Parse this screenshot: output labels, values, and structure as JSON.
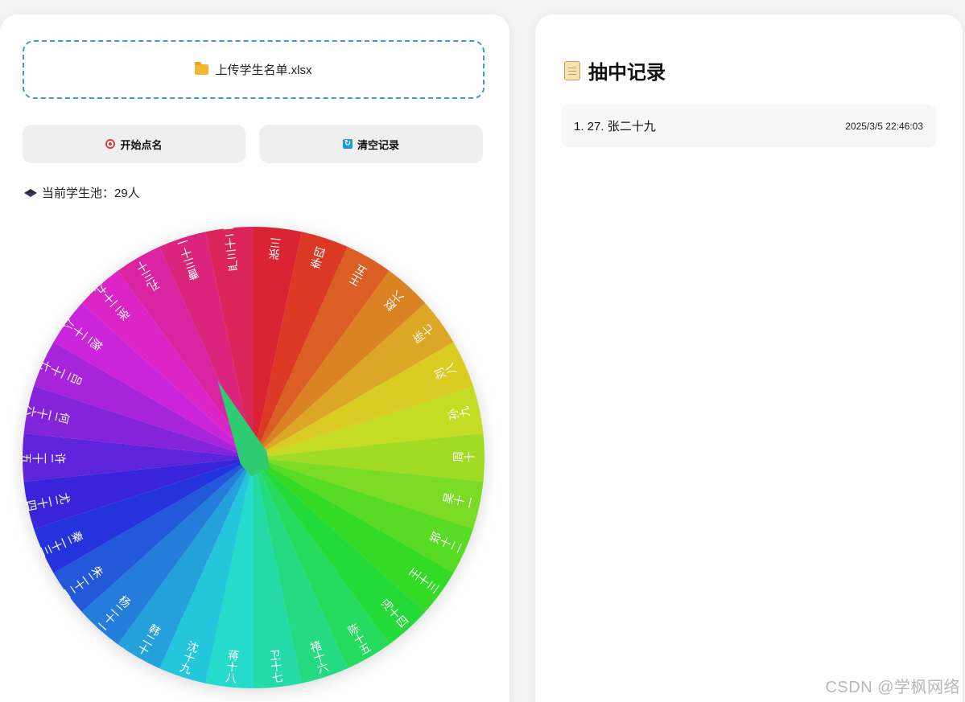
{
  "upload": {
    "icon": "folder-icon",
    "label": "上传学生名单.xlsx"
  },
  "buttons": {
    "start": {
      "icon": "target-icon",
      "label": "开始点名"
    },
    "clear": {
      "icon": "refresh-icon",
      "label": "清空记录"
    }
  },
  "pool": {
    "icon": "graduation-cap-icon",
    "label": "当前学生池：29人"
  },
  "wheel": {
    "names": [
      "张三",
      "李四",
      "王五",
      "赵六",
      "陈七",
      "刘八",
      "孙九",
      "周十",
      "吴十一",
      "郑十二",
      "王十三",
      "冯十四",
      "陈十五",
      "褚十六",
      "卫十七",
      "蒋十八",
      "沈十九",
      "韩二十",
      "杨二十一",
      "朱二十二",
      "秦二十三",
      "尤二十四",
      "许二十五",
      "何二十六",
      "吕二十七",
      "施二十八",
      "张二十九",
      "孔三十",
      "曹三十一",
      "严三十二"
    ],
    "pointer_color": "#2ecc71",
    "pointer_angle_deg": 335
  },
  "records": {
    "icon": "scroll-icon",
    "title": "抽中记录",
    "items": [
      {
        "name": "1. 27. 张二十九",
        "time": "2025/3/5 22:46:03"
      }
    ]
  },
  "watermark": "CSDN @学枫网络"
}
